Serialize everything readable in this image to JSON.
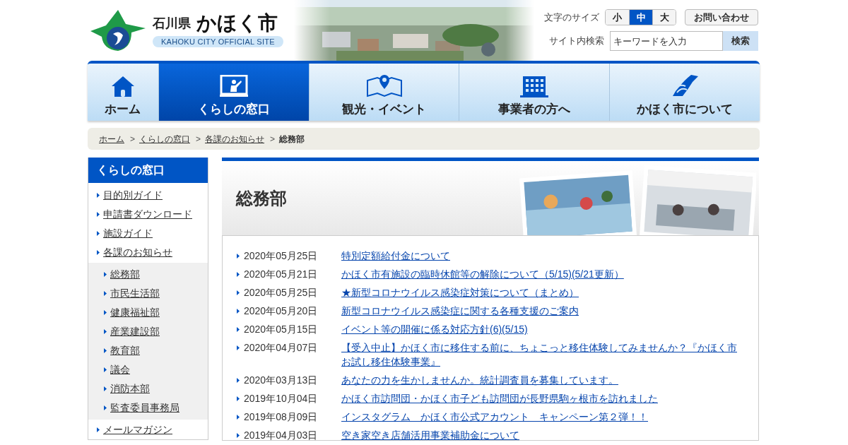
{
  "header": {
    "prefecture": "石川県",
    "city": "かほく市",
    "subtitle": "KAHOKU CITY OFFICIAL SITE",
    "font_size": {
      "label": "文字のサイズ",
      "options": [
        {
          "label": "小",
          "selected": false
        },
        {
          "label": "中",
          "selected": true
        },
        {
          "label": "大",
          "selected": false
        }
      ]
    },
    "contact": "お問い合わせ",
    "search": {
      "label": "サイト内検索",
      "placeholder": "キーワードを入力",
      "button": "検索"
    }
  },
  "nav": [
    {
      "label": "ホーム",
      "selected": false,
      "kind": "home"
    },
    {
      "label": "くらしの窓口",
      "selected": true,
      "kind": "board"
    },
    {
      "label": "観光・イベント",
      "selected": false,
      "kind": "map"
    },
    {
      "label": "事業者の方へ",
      "selected": false,
      "kind": "building"
    },
    {
      "label": "かほく市について",
      "selected": false,
      "kind": "region"
    }
  ],
  "breadcrumb": {
    "separator": ">",
    "items": [
      {
        "label": "ホーム",
        "current": false
      },
      {
        "label": "くらしの窓口",
        "current": false
      },
      {
        "label": "各課のお知らせ",
        "current": false
      },
      {
        "label": "総務部",
        "current": true
      }
    ]
  },
  "sidebar": {
    "title": "くらしの窓口",
    "items": [
      {
        "label": "目的別ガイド"
      },
      {
        "label": "申請書ダウンロード"
      },
      {
        "label": "施設ガイド"
      },
      {
        "label": "各課のお知らせ",
        "children": [
          {
            "label": "総務部"
          },
          {
            "label": "市民生活部"
          },
          {
            "label": "健康福祉部"
          },
          {
            "label": "産業建設部"
          },
          {
            "label": "教育部"
          },
          {
            "label": "議会"
          },
          {
            "label": "消防本部"
          },
          {
            "label": "監査委員事務局"
          }
        ]
      },
      {
        "label": "メールマガジン"
      }
    ]
  },
  "main": {
    "title": "総務部",
    "news": [
      {
        "date": "2020年05月25日",
        "title": "特別定額給付金について"
      },
      {
        "date": "2020年05月21日",
        "title": "かほく市有施設の臨時休館等の解除について（5/15)(5/21更新）"
      },
      {
        "date": "2020年05月25日",
        "title": "★新型コロナウイルス感染症対策について（まとめ）"
      },
      {
        "date": "2020年05月20日",
        "title": "新型コロナウイルス感染症に関する各種支援のご案内"
      },
      {
        "date": "2020年05月15日",
        "title": "イベント等の開催に係る対応方針(6)(5/15)"
      },
      {
        "date": "2020年04月07日",
        "title": "【受入中止】かほく市に移住する前に、ちょこっと移住体験してみませんか？『かほく市お試し移住体験事業』"
      },
      {
        "date": "2020年03月13日",
        "title": "あなたの力を生かしませんか。統計調査員を募集しています。"
      },
      {
        "date": "2019年10月04日",
        "title": "かほく市訪問団・かほく市子ども訪問団が長野県駒ヶ根市を訪れました"
      },
      {
        "date": "2019年08月09日",
        "title": "インスタグラム　かほく市公式アカウント　キャンペーン第２弾！！"
      },
      {
        "date": "2019年04月03日",
        "title": "空き家空き店舗活用事業補助金について"
      }
    ]
  }
}
